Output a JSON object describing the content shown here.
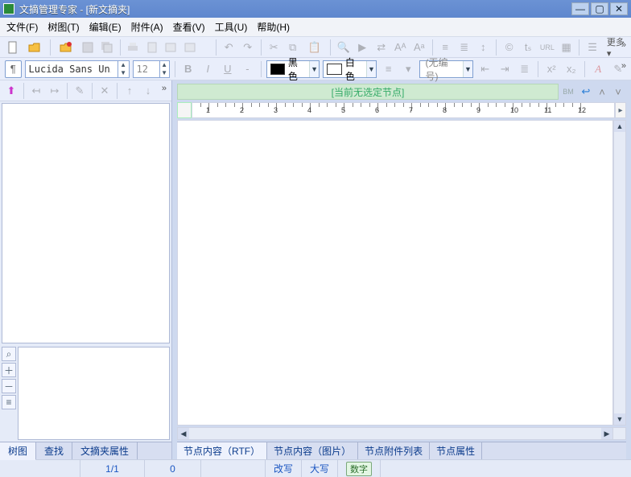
{
  "title": "文摘管理专家 - [新文摘夹]",
  "menu": {
    "file": "文件(F)",
    "tree": "树图(T)",
    "edit": "编辑(E)",
    "attach": "附件(A)",
    "view": "查看(V)",
    "tool": "工具(U)",
    "help": "帮助(H)"
  },
  "toolbar1": {
    "more": "更多▾"
  },
  "font": {
    "family": "Lucida Sans Uni",
    "size": "12"
  },
  "color": {
    "fore_label": "黑色",
    "fore_hex": "#000000",
    "back_label": "白色",
    "back_hex": "#ffffff"
  },
  "numbering": {
    "label": "(无编号)"
  },
  "message": "[当前无选定节点]",
  "bm": "BM",
  "left_tabs": {
    "t1": "树图",
    "t2": "查找",
    "t3": "文摘夹属性"
  },
  "right_tabs": {
    "t1": "节点内容（RTF）",
    "t2": "节点内容（图片）",
    "t3": "节点附件列表",
    "t4": "节点属性"
  },
  "ruler": {
    "nums": [
      "1",
      "2",
      "3",
      "4",
      "5",
      "6",
      "7",
      "8",
      "9",
      "10",
      "11",
      "12"
    ]
  },
  "status": {
    "pages": "1/1",
    "chars": "0",
    "mode1": "改写",
    "mode2": "大写",
    "tag": "数字"
  }
}
